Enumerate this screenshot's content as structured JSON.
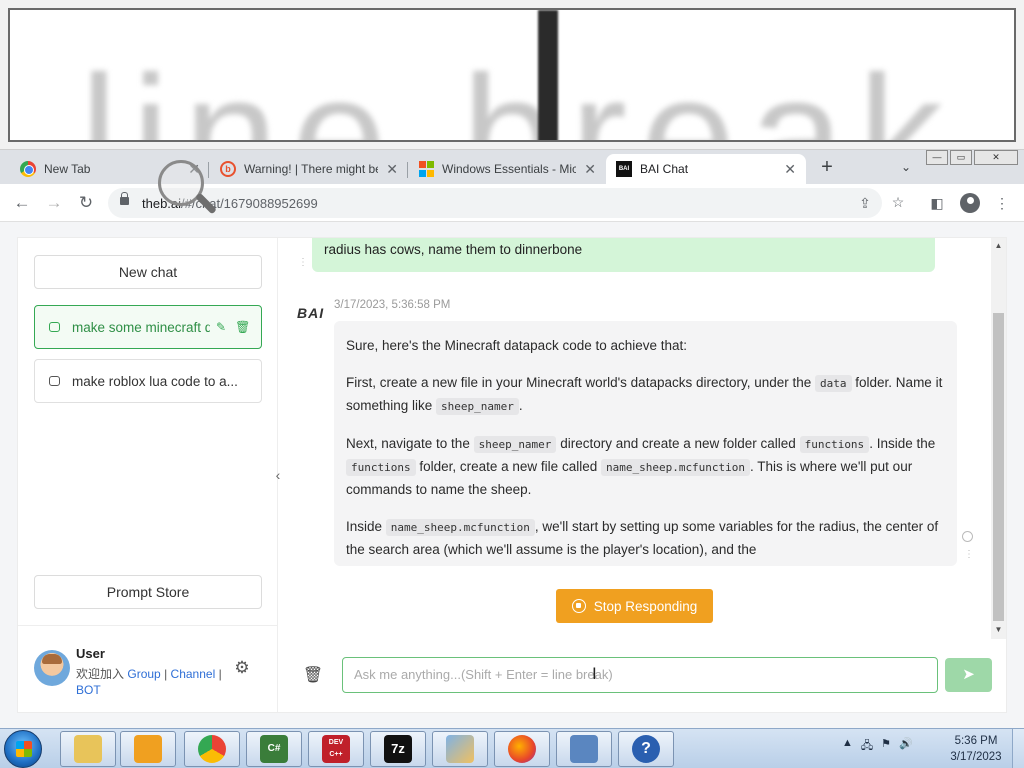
{
  "magnifier": {
    "zoomed_text": "line break"
  },
  "browser": {
    "tabs": [
      {
        "title": "New Tab",
        "icon": "chrome-icon",
        "active": false
      },
      {
        "title": "Warning! | There might be",
        "icon": "warning-site-icon",
        "active": false
      },
      {
        "title": "Windows Essentials - Mic",
        "icon": "microsoft-icon",
        "active": false
      },
      {
        "title": "BAI Chat",
        "icon": "bai-icon",
        "active": true
      }
    ],
    "new_tab_glyph": "+",
    "tab_search_glyph": "⌄",
    "window_controls": {
      "minimize": "—",
      "maximize": "▭",
      "close": "✕"
    },
    "url_host": "theb.ai",
    "url_path": "/#/chat/1679088952699"
  },
  "sidebar": {
    "new_chat_label": "New chat",
    "chats": [
      {
        "title": "make some minecraft datapack code",
        "active": true
      },
      {
        "title": "make roblox lua code to a...",
        "active": false
      }
    ],
    "prompt_store_label": "Prompt Store",
    "user": {
      "name": "User",
      "join_text": "欢迎加入",
      "link_group": "Group",
      "separator": "|",
      "link_channel": "Channel",
      "link_bot": "BOT"
    }
  },
  "conversation": {
    "user_message": "radius has cows, name them to dinnerbone",
    "bot_name": "BAI",
    "timestamp": "3/17/2023, 5:36:58 PM",
    "bot_paragraphs": {
      "p1": "Sure, here's the Minecraft datapack code to achieve that:",
      "p2a": "First, create a new file in your Minecraft world's datapacks directory, under the ",
      "p2_code1": "data",
      "p2b": " folder. Name it something like ",
      "p2_code2": "sheep_namer",
      "p2c": ".",
      "p3a": "Next, navigate to the ",
      "p3_code1": "sheep_namer",
      "p3b": " directory and create a new folder called ",
      "p3_code2": "functions",
      "p3c": ". Inside the ",
      "p3_code3": "functions",
      "p3d": " folder, create a new file called ",
      "p3_code4": "name_sheep.mcfunction",
      "p3e": ". This is where we'll put our commands to name the sheep.",
      "p4a": "Inside ",
      "p4_code1": "name_sheep.mcfunction",
      "p4b": ", we'll start by setting up some variables for the radius, the center of the search area (which we'll assume is the player's location), and the"
    },
    "stop_label": "Stop Responding",
    "input_placeholder": "Ask me anything...(Shift + Enter = line break)"
  },
  "taskbar": {
    "apps": [
      {
        "name": "file-explorer-icon",
        "label": ""
      },
      {
        "name": "media-player-icon",
        "label": ""
      },
      {
        "name": "chrome-icon",
        "label": ""
      },
      {
        "name": "csharp-icon",
        "label": "C#"
      },
      {
        "name": "devcpp-icon",
        "label": "DEV C++"
      },
      {
        "name": "7zip-icon",
        "label": "7z"
      },
      {
        "name": "paint-icon",
        "label": ""
      },
      {
        "name": "firefox-icon",
        "label": ""
      },
      {
        "name": "network-icon",
        "label": ""
      },
      {
        "name": "help-icon",
        "label": "?"
      }
    ],
    "time": "5:36 PM",
    "date": "3/17/2023"
  },
  "colors": {
    "accent_green": "#34a853",
    "user_bubble": "#d4f5d8",
    "stop_button": "#f0a020",
    "send_button": "#9ed8a8"
  }
}
